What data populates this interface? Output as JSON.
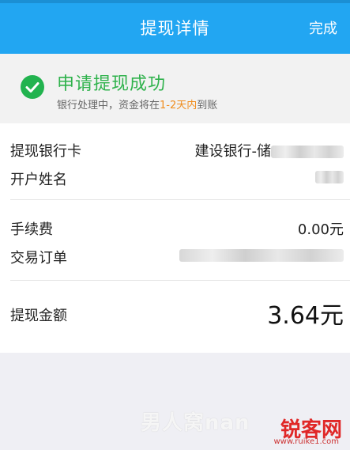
{
  "header": {
    "title": "提现详情",
    "done_label": "完成"
  },
  "status": {
    "title": "申请提现成功",
    "sub_prefix": "银行处理中，资金将在",
    "sub_highlight": "1-2天内",
    "sub_suffix": "到账"
  },
  "details": {
    "bank_label": "提现银行卡",
    "bank_value": "建设银行-储",
    "name_label": "开户姓名",
    "fee_label": "手续费",
    "fee_value": "0.00元",
    "order_label": "交易订单",
    "amount_label": "提现金额",
    "amount_value": "3.64元"
  },
  "watermark": {
    "left_text": "男人窝nan",
    "brand": "锐客网",
    "url": "www.ruike1.com"
  },
  "colors": {
    "header_bg": "#22a6f2",
    "success_green": "#2fb24c",
    "highlight_orange": "#f08c1c"
  }
}
